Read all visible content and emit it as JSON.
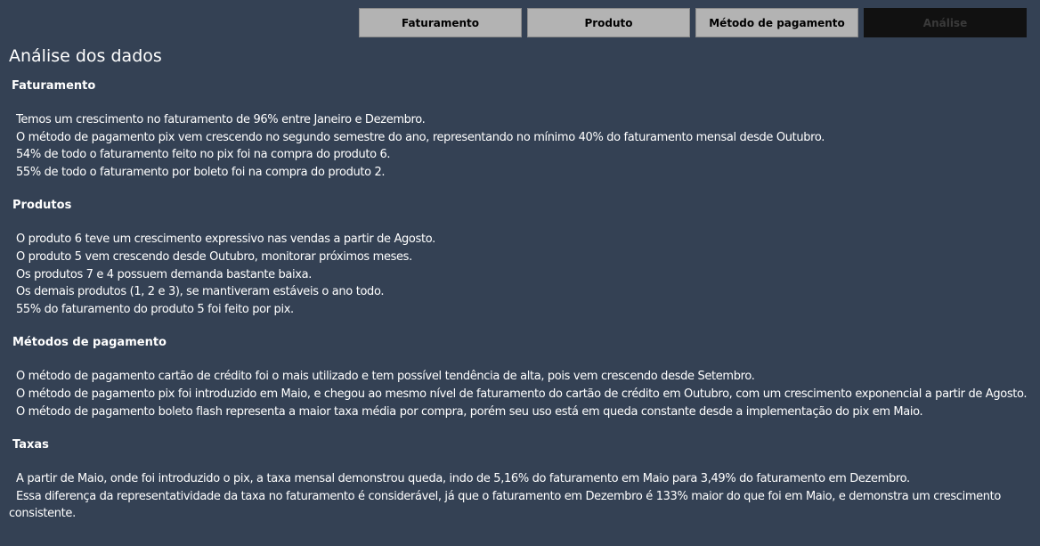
{
  "nav": {
    "buttons": [
      {
        "label": "Faturamento"
      },
      {
        "label": "Produto"
      },
      {
        "label": "Método de pagamento"
      },
      {
        "label": "Análise"
      }
    ]
  },
  "page": {
    "title": "Análise dos dados"
  },
  "sections": [
    {
      "heading": "Faturamento",
      "lines": [
        "Temos um crescimento no faturamento de 96% entre Janeiro e Dezembro.",
        "O método de pagamento pix vem crescendo no segundo semestre do ano, representando no mínimo 40% do faturamento mensal desde Outubro.",
        "54% de todo o faturamento feito no pix foi na compra do produto 6.",
        "55% de todo o faturamento por boleto foi na compra do produto 2."
      ]
    },
    {
      "heading": "Produtos",
      "lines": [
        "O produto 6 teve um crescimento expressivo nas vendas a partir de Agosto.",
        "O produto 5 vem crescendo desde Outubro, monitorar próximos meses.",
        "Os produtos 7 e 4 possuem demanda bastante baixa.",
        "Os demais produtos (1, 2 e 3), se mantiveram estáveis o ano todo.",
        "55% do faturamento do produto 5 foi feito por pix."
      ]
    },
    {
      "heading": "Métodos de pagamento",
      "lines": [
        "O método de pagamento cartão de crédito foi o mais utilizado e tem possível tendência de alta, pois vem crescendo desde Setembro.",
        "O método de pagamento pix foi introduzido em Maio, e chegou ao mesmo nível de faturamento do cartão de crédito em Outubro, com um crescimento exponencial a partir de Agosto.",
        "O método de pagamento boleto flash representa a maior taxa média por compra, porém seu uso está em queda constante desde a implementação do pix em Maio."
      ]
    },
    {
      "heading": "Taxas",
      "lines": [
        "A partir de Maio, onde foi introduzido o pix, a taxa mensal demonstrou queda, indo de 5,16% do faturamento em Maio para 3,49% do faturamento em Dezembro.",
        "Essa diferença da representatividade da taxa no faturamento é considerável, já que o faturamento em Dezembro é 133% maior do que foi em Maio, e demonstra um crescimento consistente."
      ]
    }
  ]
}
